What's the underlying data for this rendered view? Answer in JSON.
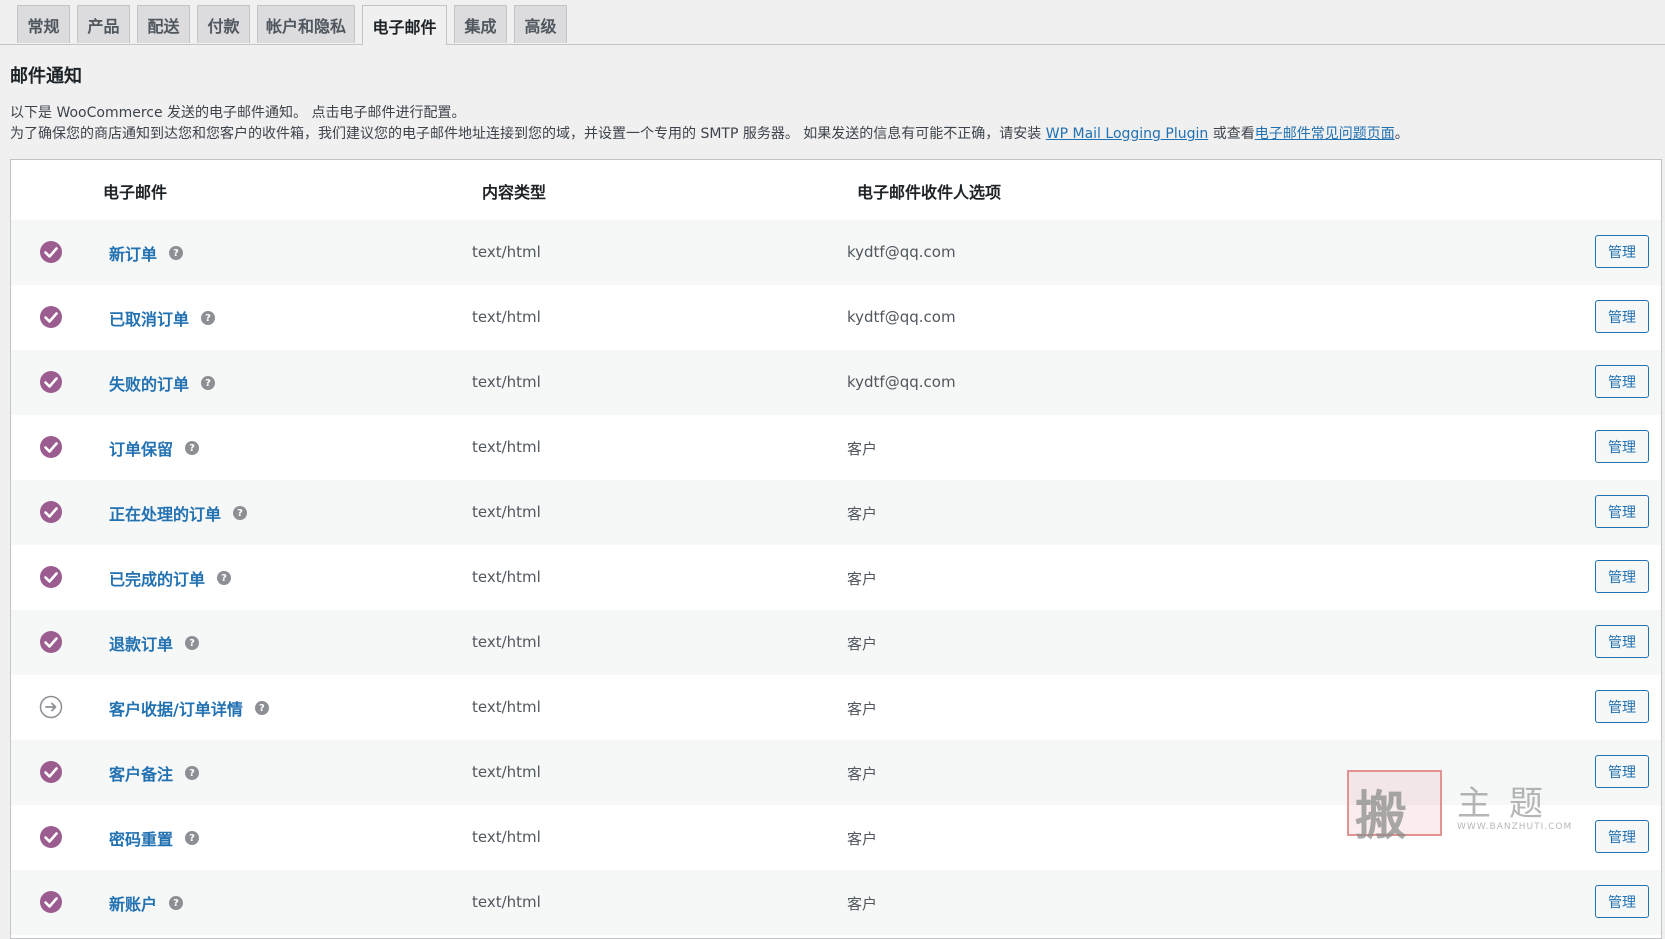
{
  "tabs": [
    {
      "label": "常规",
      "active": false
    },
    {
      "label": "产品",
      "active": false
    },
    {
      "label": "配送",
      "active": false
    },
    {
      "label": "付款",
      "active": false
    },
    {
      "label": "帐户和隐私",
      "active": false
    },
    {
      "label": "电子邮件",
      "active": true
    },
    {
      "label": "集成",
      "active": false
    },
    {
      "label": "高级",
      "active": false
    }
  ],
  "page": {
    "title": "邮件通知",
    "desc_line1": "以下是 WooCommerce 发送的电子邮件通知。 点击电子邮件进行配置。",
    "desc_line2_before": "为了确保您的商店通知到达您和您客户的收件箱，我们建议您的电子邮件地址连接到您的域，并设置一个专用的 SMTP 服务器。 如果发送的信息有可能不正确，请安装 ",
    "desc_link1": "WP Mail Logging Plugin",
    "desc_line2_middle": " 或查看",
    "desc_link2": "电子邮件常见问题页面",
    "desc_line2_after": "。"
  },
  "table": {
    "headers": {
      "email": "电子邮件",
      "content_type": "内容类型",
      "recipient": "电子邮件收件人选项"
    },
    "manage_label": "管理",
    "rows": [
      {
        "name": "新订单",
        "content_type": "text/html",
        "recipient": "kydtf@qq.com",
        "status": "enabled"
      },
      {
        "name": "已取消订单",
        "content_type": "text/html",
        "recipient": "kydtf@qq.com",
        "status": "enabled"
      },
      {
        "name": "失败的订单",
        "content_type": "text/html",
        "recipient": "kydtf@qq.com",
        "status": "enabled"
      },
      {
        "name": "订单保留",
        "content_type": "text/html",
        "recipient": "客户",
        "status": "enabled"
      },
      {
        "name": "正在处理的订单",
        "content_type": "text/html",
        "recipient": "客户",
        "status": "enabled"
      },
      {
        "name": "已完成的订单",
        "content_type": "text/html",
        "recipient": "客户",
        "status": "enabled"
      },
      {
        "name": "退款订单",
        "content_type": "text/html",
        "recipient": "客户",
        "status": "enabled"
      },
      {
        "name": "客户收据/订单详情",
        "content_type": "text/html",
        "recipient": "客户",
        "status": "manual"
      },
      {
        "name": "客户备注",
        "content_type": "text/html",
        "recipient": "客户",
        "status": "enabled"
      },
      {
        "name": "密码重置",
        "content_type": "text/html",
        "recipient": "客户",
        "status": "enabled"
      },
      {
        "name": "新账户",
        "content_type": "text/html",
        "recipient": "客户",
        "status": "enabled"
      }
    ]
  },
  "watermark": {
    "glyph": "搬",
    "text": "主题",
    "url": "WWW.BANZHUTI.COM"
  },
  "colors": {
    "enabled": "#9b5c8f",
    "manual": "#8c8f94",
    "link": "#2271b1"
  }
}
